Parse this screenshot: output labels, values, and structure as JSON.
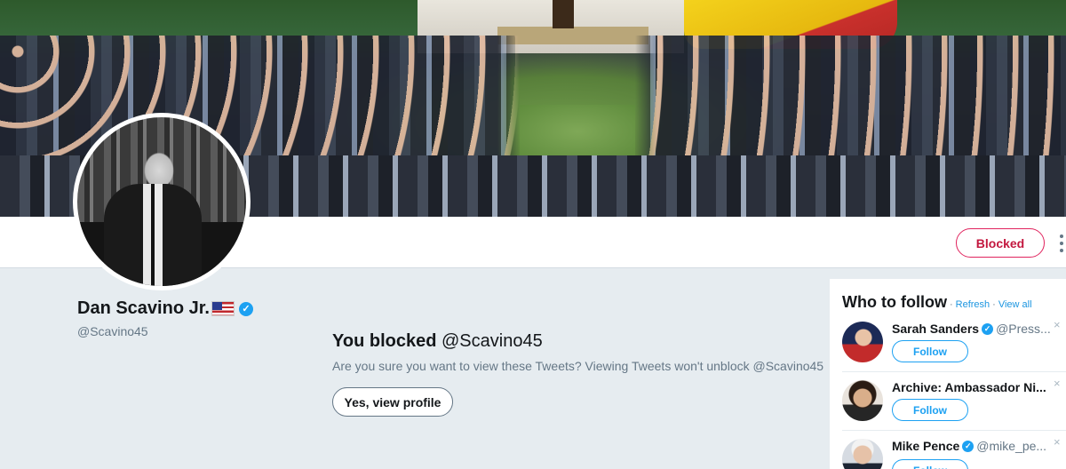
{
  "profile": {
    "name": "Dan Scavino Jr.",
    "flag": "us-flag-icon",
    "verified": "✓",
    "handle": "@Scavino45"
  },
  "navbar": {
    "blocked_label": "Blocked",
    "more": "more-icon"
  },
  "blocked_message": {
    "title_prefix": "You blocked",
    "title_handle": "@Scavino45",
    "description": "Are you sure you want to view these Tweets? Viewing Tweets won't unblock @Scavino45",
    "button_label": "Yes, view profile"
  },
  "who_to_follow": {
    "title": "Who to follow",
    "dot": "·",
    "refresh": "Refresh",
    "view_all": "View all",
    "dismiss": "×",
    "suggestions": [
      {
        "name": "Sarah Sanders",
        "verified": "✓",
        "handle": "@Press...",
        "follow_label": "Follow"
      },
      {
        "name": "Archive: Ambassador Ni...",
        "handle": "",
        "follow_label": "Follow"
      },
      {
        "name": "Mike Pence",
        "verified": "✓",
        "handle": "@mike_pe...",
        "follow_label": "Follow"
      }
    ]
  },
  "colors": {
    "accent_blue": "#1da1f2",
    "blocked_red": "#e0245e",
    "page_bg": "#e6ecf0"
  }
}
